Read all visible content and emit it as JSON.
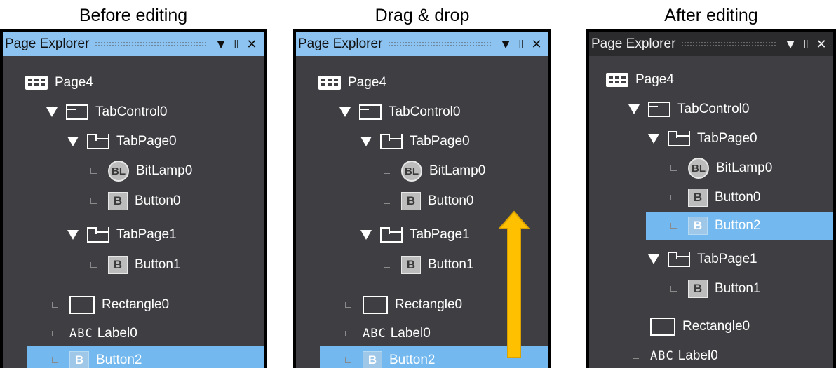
{
  "captions": {
    "before": "Before editing",
    "dragdrop": "Drag & drop",
    "after": "After editing"
  },
  "panel": {
    "title": "Page Explorer",
    "dropdown_icon": "chevron-down-icon",
    "pin_icon": "pin-icon",
    "close_icon": "close-icon",
    "pin_glyph": "\u0001",
    "close_glyph": "✕"
  },
  "nodes": {
    "page4": "Page4",
    "tabcontrol0": "TabControl0",
    "tabpage0": "TabPage0",
    "bitlamp0": "BitLamp0",
    "bitlamp_badge": "BL",
    "button_badge": "B",
    "button0": "Button0",
    "tabpage1": "TabPage1",
    "button1": "Button1",
    "rectangle0": "Rectangle0",
    "abc_badge": "ABC",
    "label0": "Label0",
    "button2": "Button2"
  },
  "colors": {
    "panel_bg": "#3f3f43",
    "active_titlebar": "#8dc3f1",
    "selection": "#73b8ee",
    "arrow": "#ffc000",
    "arrow_border": "#d9a200"
  }
}
